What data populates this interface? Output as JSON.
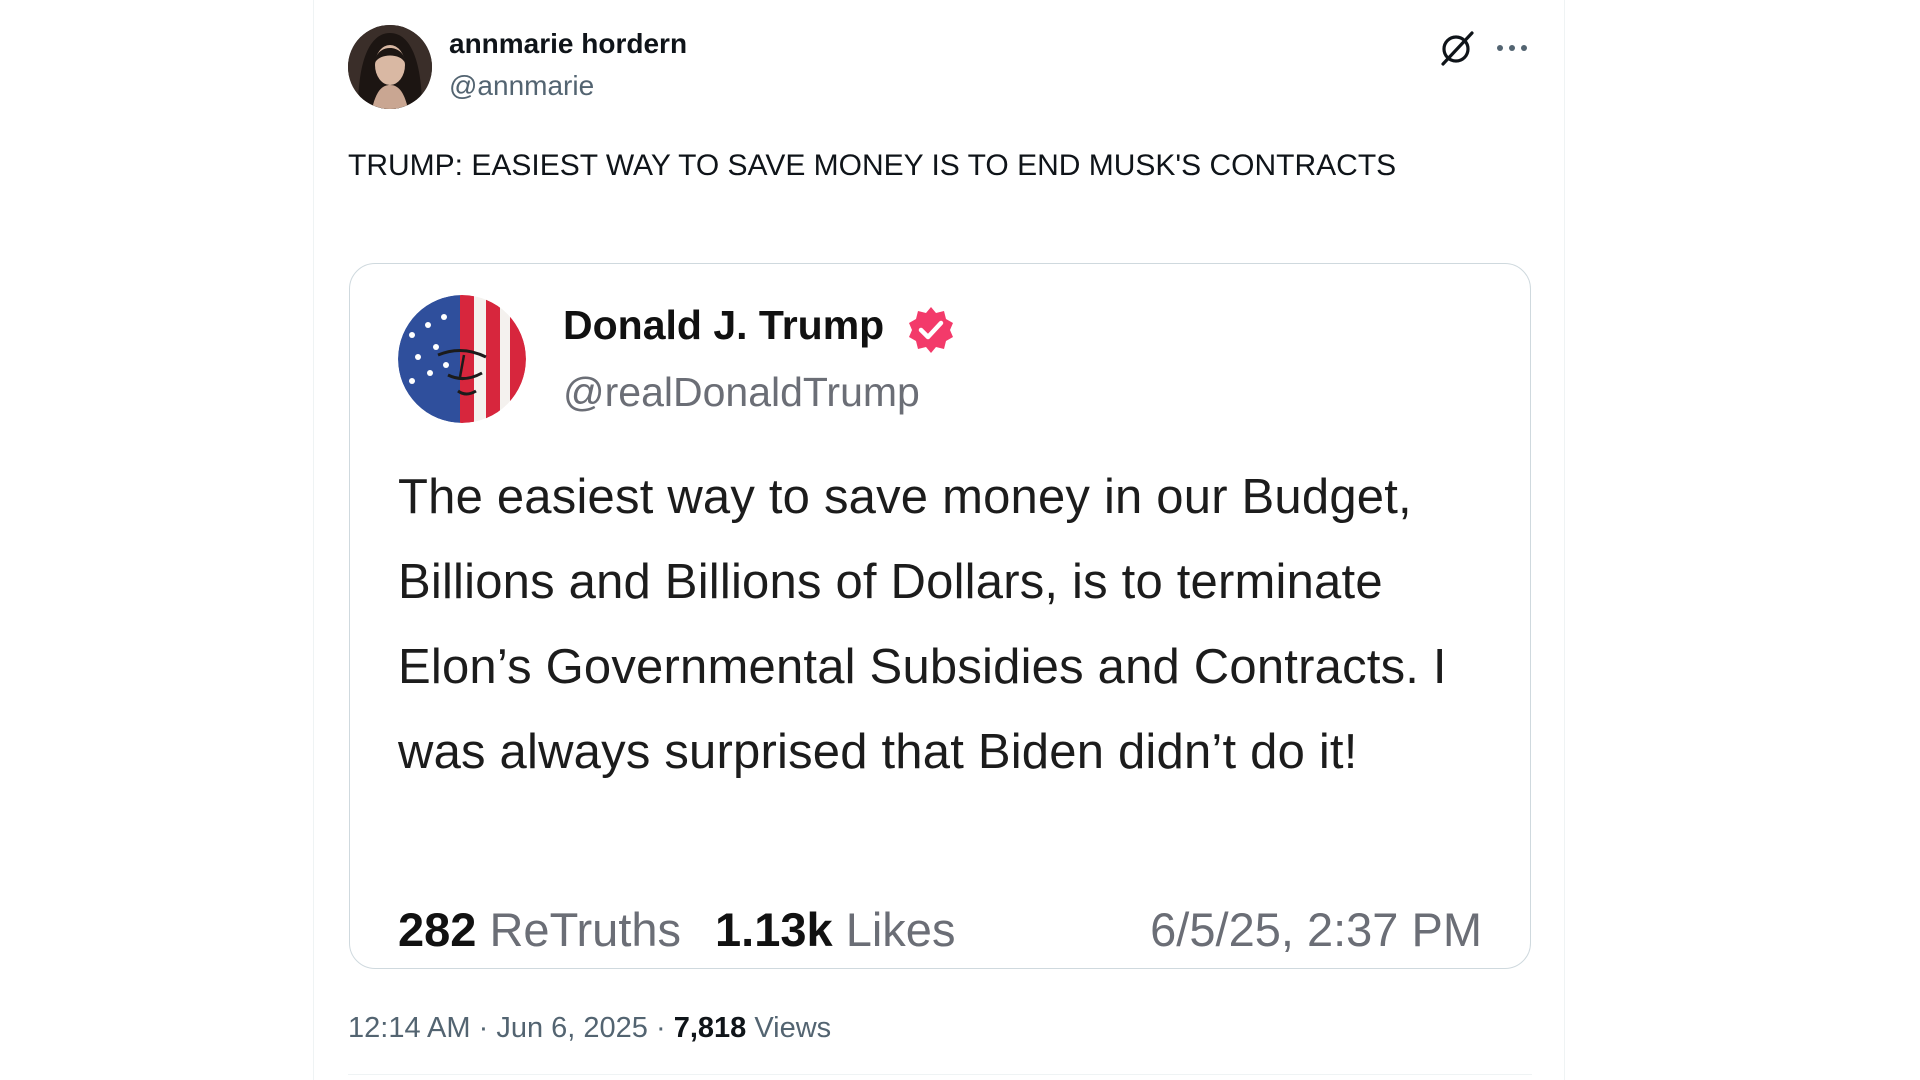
{
  "tweet": {
    "author_name": "annmarie hordern",
    "author_handle": "@annmarie",
    "text": "TRUMP: EASIEST WAY TO SAVE MONEY IS TO END MUSK'S CONTRACTS",
    "time": "12:14 AM",
    "separator": "·",
    "date": "Jun 6, 2025",
    "views_count": "7,818",
    "views_label": "Views"
  },
  "quote": {
    "author_name": "Donald J. Trump",
    "author_handle": "@realDonaldTrump",
    "text": "The easiest way to save money in our Budget, Billions and Billions of Dollars, is to terminate Elon’s Governmental Subsidies and Contracts. I was always surprised that Biden didn’t do it!",
    "retruths_count": "282",
    "retruths_label": "ReTruths",
    "likes_count": "1.13k",
    "likes_label": "Likes",
    "posted_at": "6/5/25, 2:37 PM"
  },
  "icons": {
    "grok": "grok-icon",
    "more": "more-options-icon",
    "verified": "verified-badge-icon"
  },
  "colors": {
    "text_primary": "#0f1419",
    "text_secondary": "#536471",
    "border": "#cfd9de",
    "verified_badge": "#f33a6a"
  }
}
